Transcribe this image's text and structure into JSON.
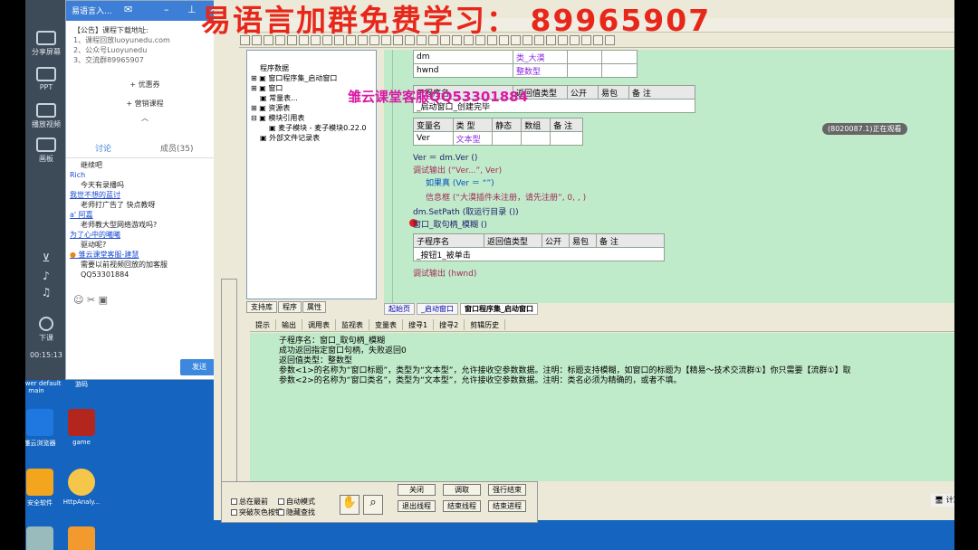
{
  "overlay": {
    "banner": "易语言加群免费学习：  89965907",
    "qq": "雏云课堂客服QQ53301884"
  },
  "left_strip": {
    "buttons": [
      "分享屏幕",
      "PPT",
      "播放视频",
      "画板",
      "下课"
    ],
    "time": "00:15:13"
  },
  "chat": {
    "title": "易语言入...",
    "notice_title": "【公告】",
    "notice_lines": [
      "课程下载地址:",
      "1、课程回放luoyunedu.com",
      "2、公众号Luoyunedu",
      "3、交流群89965907"
    ],
    "menu": [
      "优惠券",
      "营销课程"
    ],
    "tab_discuss": "讨论",
    "tab_members": "成员(35)",
    "messages": [
      {
        "user": "",
        "text": "继续吧"
      },
      {
        "user": "Rich",
        "text": "今天有录播吗"
      },
      {
        "user": "",
        "text": "我世不想的蓝讨",
        "link": true
      },
      {
        "user": "",
        "text": "老师打广告了     快点教呀"
      },
      {
        "user": "",
        "text": "a' 阿嘉",
        "link": true
      },
      {
        "user": "",
        "text": "老师教大型网络游戏吗?"
      },
      {
        "user": "",
        "text": "为了心中的曦曦",
        "link": true
      },
      {
        "user": "",
        "text": "驱动呢?"
      },
      {
        "user": "雏云课堂客服-建慧",
        "text": "需要以前视频回放的加客服"
      },
      {
        "user": "",
        "text": "QQ53301884"
      }
    ],
    "send": "发送"
  },
  "desktop": {
    "icons": [
      "nViewer default main",
      "游码",
      "雏云浏览器",
      "game",
      "安全软件",
      "HttpAnaly..."
    ]
  },
  "tree": {
    "items": [
      "程序数据",
      "窗口程序集_启动窗口",
      "窗口",
      "常量表...",
      "资源表",
      "模块引用表",
      "麦子模块 - 麦子模块0.22.0",
      "外部文件记录表"
    ],
    "tabs": [
      "支持库",
      "程序",
      "属性"
    ]
  },
  "editor": {
    "vars": [
      [
        "dm",
        "类_大漠"
      ],
      [
        "hwnd",
        "整数型"
      ]
    ],
    "sub1_header": [
      "子程序名",
      "返回值类型",
      "公开",
      "易包",
      "备 注"
    ],
    "sub1_row": [
      "_启动窗口_创建完毕"
    ],
    "var_header": [
      "变量名",
      "类 型",
      "静态",
      "数组",
      "备 注"
    ],
    "var_row": [
      "Ver",
      "文本型"
    ],
    "lines": [
      "Ver ＝ dm.Ver ()",
      "调试输出 (“Ver...”, Ver)",
      "如果真 (Ver ＝ “”)",
      "信息框 (“大漠插件未注册，请先注册”, 0, , )",
      "dm.SetPath (取运行目录 ())",
      "窗口_取句柄_模糊 ()"
    ],
    "sub2_header": [
      "子程序名",
      "返回值类型",
      "公开",
      "易包",
      "备 注"
    ],
    "sub2_row": [
      "_按钮1_被单击"
    ],
    "last_line": "调试输出 (hwnd)",
    "tabs": [
      "起始页",
      "_启动窗口",
      "窗口程序集_启动窗口"
    ]
  },
  "bottom": {
    "tabs": [
      "提示",
      "输出",
      "调用表",
      "监视表",
      "变量表",
      "搜寻1",
      "搜寻2",
      "剪辑历史"
    ],
    "output_lines": [
      "子程序名：窗口_取句柄_模糊",
      "成功返回指定窗口句柄，失败返回0",
      "返回值类型：整数型",
      "参数<1>的名称为“窗口标题”，类型为“文本型”，允许接收空参数数据。注明：标题支持模糊，如窗口的标题为【精易〜技术交流群①】你只需要【流群①】取",
      "参数<2>的名称为“窗口类名”，类型为“文本型”，允许接收空参数数据。注明：类名必须为精确的，或者不填。"
    ],
    "panel_checks": [
      "总在最前",
      "自动模式",
      "突破灰色按钮",
      "隐藏查找"
    ],
    "panel_buttons": [
      "退出线程",
      "结束线程",
      "结束进程"
    ],
    "panel_buttons_top": [
      "关闭",
      "调取",
      "强行结束"
    ]
  },
  "taskbar": {
    "label": "计算机"
  },
  "gray_label": "(8020087.1)正在观看"
}
